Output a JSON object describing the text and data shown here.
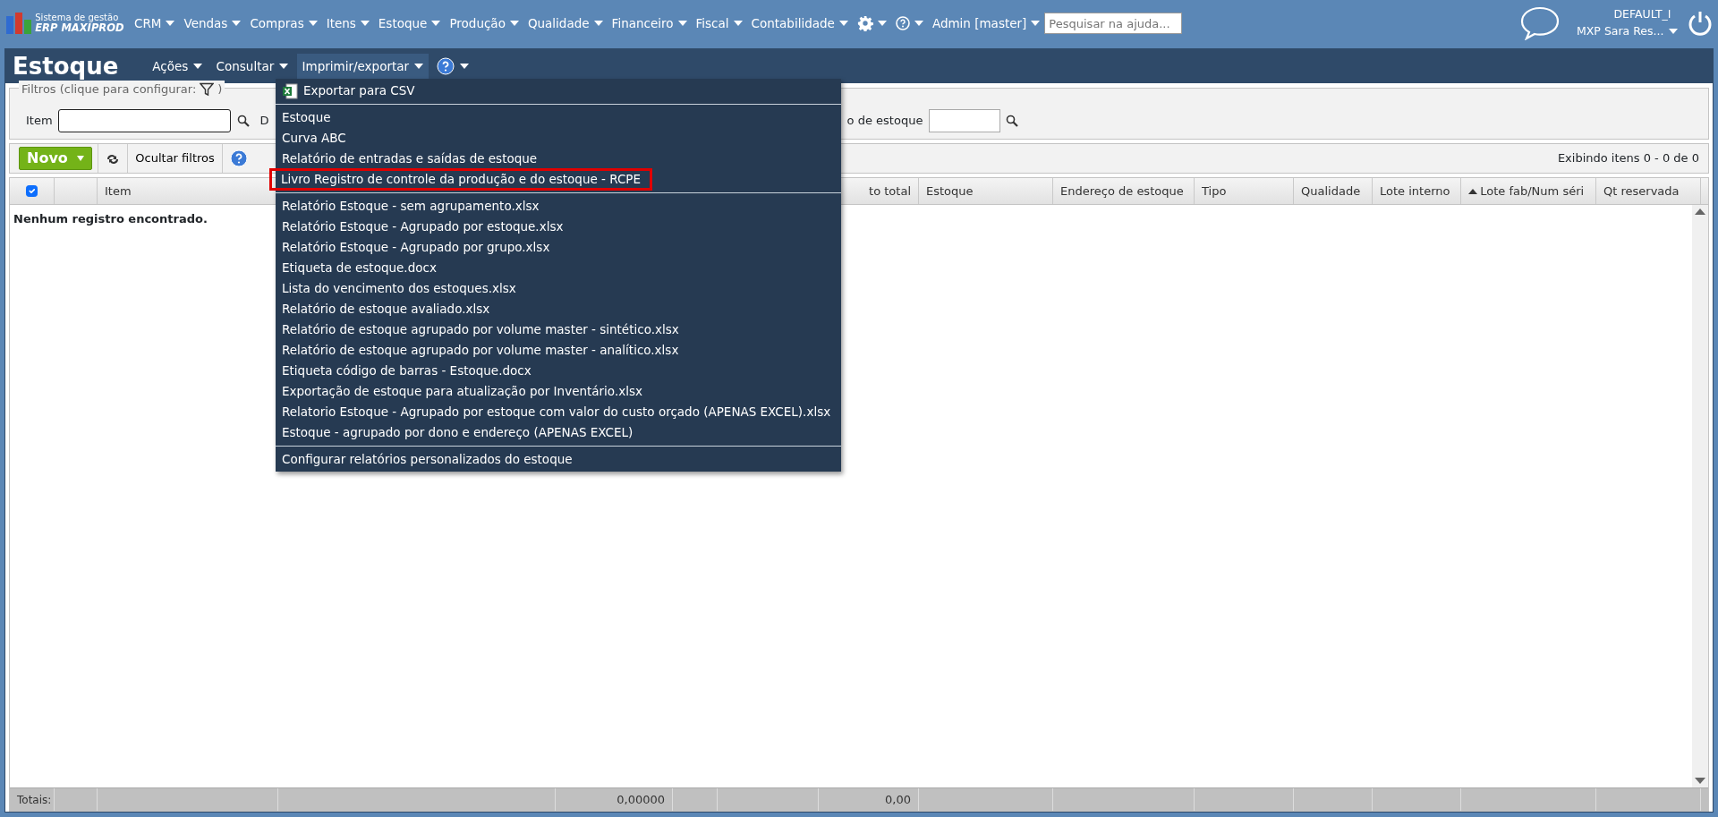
{
  "topbar": {
    "logo": {
      "line1": "Sistema de gestão",
      "line2": "ERP MAXIPROD"
    },
    "menus": [
      {
        "kind": "text",
        "label": "CRM"
      },
      {
        "kind": "text",
        "label": "Vendas"
      },
      {
        "kind": "text",
        "label": "Compras"
      },
      {
        "kind": "text",
        "label": "Itens"
      },
      {
        "kind": "text",
        "label": "Estoque"
      },
      {
        "kind": "text",
        "label": "Produção"
      },
      {
        "kind": "text",
        "label": "Qualidade"
      },
      {
        "kind": "text",
        "label": "Financeiro"
      },
      {
        "kind": "text",
        "label": "Fiscal"
      },
      {
        "kind": "text",
        "label": "Contabilidade"
      },
      {
        "kind": "gear"
      },
      {
        "kind": "help"
      },
      {
        "kind": "text",
        "label": "Admin [master]"
      }
    ],
    "search": {
      "placeholder": "Pesquisar na ajuda..."
    },
    "company": "DEFAULT_I",
    "user": "MXP Sara Res..."
  },
  "page": {
    "title": "Estoque",
    "menus": [
      {
        "kind": "text",
        "label": "Ações",
        "selected": false
      },
      {
        "kind": "text",
        "label": "Consultar",
        "selected": false
      },
      {
        "kind": "text",
        "label": "Imprimir/exportar",
        "selected": true
      },
      {
        "kind": "help",
        "selected": false
      }
    ]
  },
  "filters": {
    "legend": "Filtros (clique para configurar:",
    "legend_end": ")",
    "fields": [
      {
        "label": "Item",
        "kind": "input"
      },
      {
        "label": "D",
        "kind": "label"
      },
      {
        "label": "o de estoque",
        "kind": "input"
      }
    ]
  },
  "toolbar": {
    "new_button": "Novo",
    "hide_filters": "Ocultar filtros",
    "status": "Exibindo itens 0 - 0 de 0"
  },
  "table": {
    "select_all_checked": true,
    "columns": [
      {
        "label": "Item",
        "sorted": false
      },
      {
        "label": "to total",
        "sorted": false
      },
      {
        "label": "Estoque",
        "sorted": false
      },
      {
        "label": "Endereço de estoque",
        "sorted": false
      },
      {
        "label": "Tipo",
        "sorted": false
      },
      {
        "label": "Qualidade",
        "sorted": false
      },
      {
        "label": "Lote interno",
        "sorted": false
      },
      {
        "label": "Lote fab/Num séri",
        "sorted": true
      },
      {
        "label": "Qt reservada",
        "sorted": false
      }
    ],
    "empty_message": "Nenhum registro encontrado.",
    "totals": [
      "Totais:",
      "0,00000",
      "0,00"
    ]
  },
  "dropdown": {
    "sections": [
      [
        {
          "label": "Exportar para CSV",
          "kind": "excel",
          "highlighted": false
        }
      ],
      [
        {
          "label": "Estoque",
          "kind": "text",
          "highlighted": false
        },
        {
          "label": "Curva ABC",
          "kind": "text",
          "highlighted": false
        },
        {
          "label": "Relatório de entradas e saídas de estoque",
          "kind": "text",
          "highlighted": false
        },
        {
          "label": "Livro Registro de controle da produção e do estoque - RCPE",
          "kind": "text",
          "highlighted": true
        }
      ],
      [
        {
          "label": "Relatório Estoque - sem agrupamento.xlsx",
          "kind": "text",
          "highlighted": false
        },
        {
          "label": "Relatório Estoque - Agrupado por estoque.xlsx",
          "kind": "text",
          "highlighted": false
        },
        {
          "label": "Relatório Estoque - Agrupado por grupo.xlsx",
          "kind": "text",
          "highlighted": false
        },
        {
          "label": "Etiqueta de estoque.docx",
          "kind": "text",
          "highlighted": false
        },
        {
          "label": "Lista do vencimento dos estoques.xlsx",
          "kind": "text",
          "highlighted": false
        },
        {
          "label": "Relatório de estoque avaliado.xlsx",
          "kind": "text",
          "highlighted": false
        },
        {
          "label": "Relatório de estoque agrupado por volume master - sintético.xlsx",
          "kind": "text",
          "highlighted": false
        },
        {
          "label": "Relatório de estoque agrupado por volume master - analítico.xlsx",
          "kind": "text",
          "highlighted": false
        },
        {
          "label": "Etiqueta código de barras - Estoque.docx",
          "kind": "text",
          "highlighted": false
        },
        {
          "label": "Exportação de estoque para atualização por Inventário.xlsx",
          "kind": "text",
          "highlighted": false
        },
        {
          "label": "Relatorio Estoque - Agrupado por estoque com valor do custo orçado (APENAS EXCEL).xlsx",
          "kind": "text",
          "highlighted": false
        },
        {
          "label": "Estoque - agrupado por dono e endereço (APENAS EXCEL)",
          "kind": "text",
          "highlighted": false
        }
      ],
      [
        {
          "label": "Configurar relatórios personalizados do estoque",
          "kind": "text",
          "highlighted": false
        }
      ]
    ]
  }
}
